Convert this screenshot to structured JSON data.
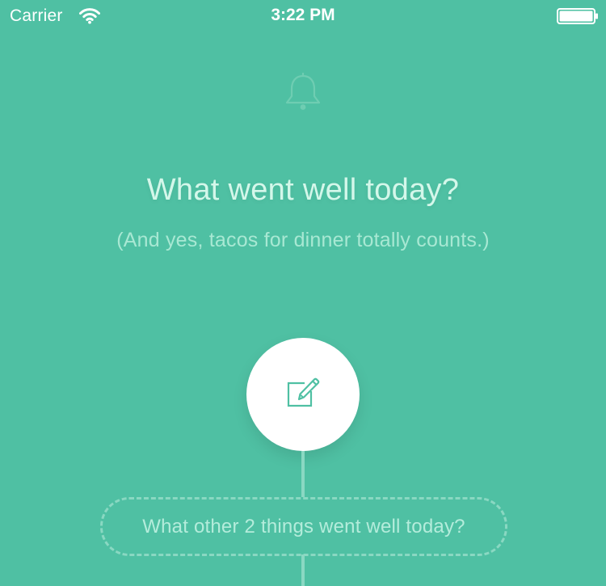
{
  "status_bar": {
    "carrier": "Carrier",
    "time": "3:22 PM",
    "wifi_icon": "wifi-icon",
    "battery_icon": "battery-icon"
  },
  "reminder": {
    "icon": "bell-icon"
  },
  "prompt": {
    "title": "What went well today?",
    "subtitle": "(And yes, tacos for dinner totally counts.)"
  },
  "compose": {
    "icon": "compose-icon"
  },
  "next_prompt": {
    "label": "What other 2 things went well today?"
  },
  "colors": {
    "background": "#4fc0a3",
    "accent": "#4fc0a3",
    "title_text": "#d4f7ea",
    "muted_text": "#a8e8d3",
    "connector": "#8ad8c2"
  }
}
